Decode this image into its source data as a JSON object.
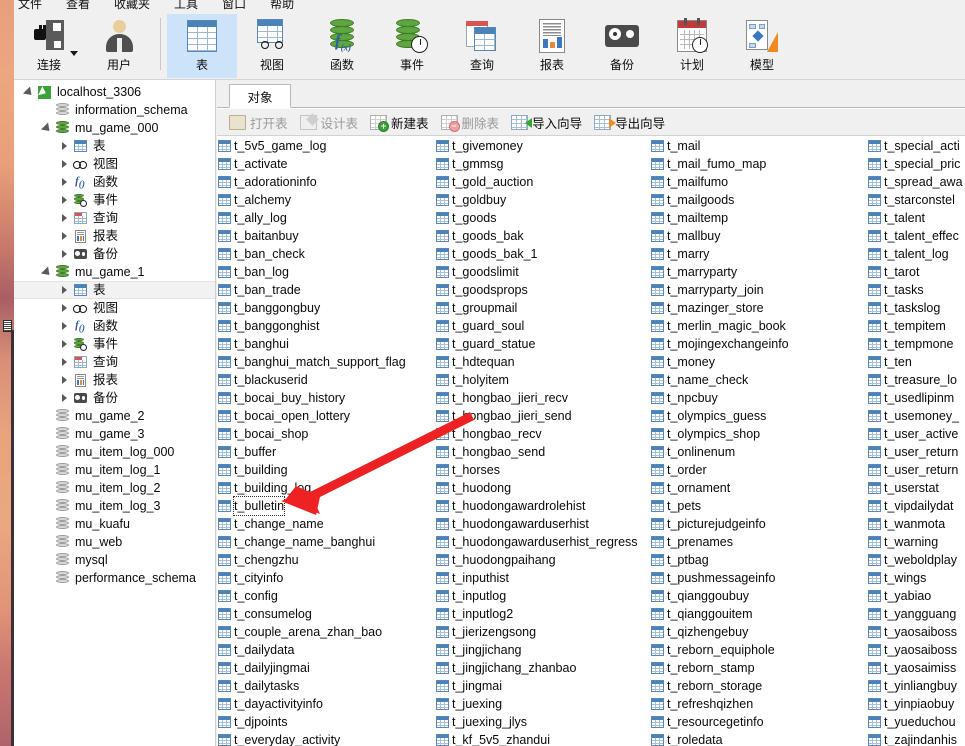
{
  "menu": {
    "items": [
      "文件",
      "查看",
      "收藏夹",
      "工具",
      "窗口",
      "帮助"
    ]
  },
  "toolbar": {
    "buttons": [
      {
        "label": "连接",
        "icon": "connection-icon",
        "active": false,
        "dropdown": true
      },
      {
        "label": "用户",
        "icon": "user-icon",
        "active": false,
        "dropdown": false
      },
      {
        "label": "表",
        "icon": "table-icon",
        "active": true,
        "dropdown": false
      },
      {
        "label": "视图",
        "icon": "view-icon",
        "active": false,
        "dropdown": false
      },
      {
        "label": "函数",
        "icon": "function-icon",
        "active": false,
        "dropdown": false
      },
      {
        "label": "事件",
        "icon": "event-icon",
        "active": false,
        "dropdown": false
      },
      {
        "label": "查询",
        "icon": "query-icon",
        "active": false,
        "dropdown": false
      },
      {
        "label": "报表",
        "icon": "report-icon",
        "active": false,
        "dropdown": false
      },
      {
        "label": "备份",
        "icon": "backup-icon",
        "active": false,
        "dropdown": false
      },
      {
        "label": "计划",
        "icon": "schedule-icon",
        "active": false,
        "dropdown": false
      },
      {
        "label": "模型",
        "icon": "model-icon",
        "active": false,
        "dropdown": false
      }
    ]
  },
  "sidebar": {
    "nodes": [
      {
        "label": "localhost_3306",
        "icon": "host-icon",
        "indent": 0,
        "twisty": "expanded"
      },
      {
        "label": "information_schema",
        "icon": "db-grey-icon",
        "indent": 1,
        "twisty": "none"
      },
      {
        "label": "mu_game_000",
        "icon": "db-green-icon",
        "indent": 1,
        "twisty": "expanded"
      },
      {
        "label": "表",
        "icon": "table-icon",
        "indent": 2,
        "twisty": "collapsed"
      },
      {
        "label": "视图",
        "icon": "view-icon",
        "indent": 2,
        "twisty": "collapsed"
      },
      {
        "label": "函数",
        "icon": "function-icon",
        "indent": 2,
        "twisty": "collapsed"
      },
      {
        "label": "事件",
        "icon": "event-icon",
        "indent": 2,
        "twisty": "collapsed"
      },
      {
        "label": "查询",
        "icon": "query-icon",
        "indent": 2,
        "twisty": "collapsed"
      },
      {
        "label": "报表",
        "icon": "report-icon",
        "indent": 2,
        "twisty": "collapsed"
      },
      {
        "label": "备份",
        "icon": "backup-icon",
        "indent": 2,
        "twisty": "collapsed"
      },
      {
        "label": "mu_game_1",
        "icon": "db-green-icon",
        "indent": 1,
        "twisty": "expanded"
      },
      {
        "label": "表",
        "icon": "table-icon",
        "indent": 2,
        "twisty": "collapsed",
        "selected": true
      },
      {
        "label": "视图",
        "icon": "view-icon",
        "indent": 2,
        "twisty": "collapsed"
      },
      {
        "label": "函数",
        "icon": "function-icon",
        "indent": 2,
        "twisty": "collapsed"
      },
      {
        "label": "事件",
        "icon": "event-icon",
        "indent": 2,
        "twisty": "collapsed"
      },
      {
        "label": "查询",
        "icon": "query-icon",
        "indent": 2,
        "twisty": "collapsed"
      },
      {
        "label": "报表",
        "icon": "report-icon",
        "indent": 2,
        "twisty": "collapsed"
      },
      {
        "label": "备份",
        "icon": "backup-icon",
        "indent": 2,
        "twisty": "collapsed"
      },
      {
        "label": "mu_game_2",
        "icon": "db-grey-icon",
        "indent": 1,
        "twisty": "none"
      },
      {
        "label": "mu_game_3",
        "icon": "db-grey-icon",
        "indent": 1,
        "twisty": "none"
      },
      {
        "label": "mu_item_log_000",
        "icon": "db-grey-icon",
        "indent": 1,
        "twisty": "none"
      },
      {
        "label": "mu_item_log_1",
        "icon": "db-grey-icon",
        "indent": 1,
        "twisty": "none"
      },
      {
        "label": "mu_item_log_2",
        "icon": "db-grey-icon",
        "indent": 1,
        "twisty": "none"
      },
      {
        "label": "mu_item_log_3",
        "icon": "db-grey-icon",
        "indent": 1,
        "twisty": "none"
      },
      {
        "label": "mu_kuafu",
        "icon": "db-grey-icon",
        "indent": 1,
        "twisty": "none"
      },
      {
        "label": "mu_web",
        "icon": "db-grey-icon",
        "indent": 1,
        "twisty": "none"
      },
      {
        "label": "mysql",
        "icon": "db-grey-icon",
        "indent": 1,
        "twisty": "none"
      },
      {
        "label": "performance_schema",
        "icon": "db-grey-icon",
        "indent": 1,
        "twisty": "none"
      }
    ]
  },
  "main": {
    "tab": "对象",
    "actions": [
      {
        "label": "打开表",
        "icon": "open-table-icon",
        "enabled": false
      },
      {
        "label": "设计表",
        "icon": "design-table-icon",
        "enabled": false
      },
      {
        "label": "新建表",
        "icon": "new-table-icon",
        "enabled": true
      },
      {
        "label": "删除表",
        "icon": "delete-table-icon",
        "enabled": false
      },
      {
        "label": "导入向导",
        "icon": "import-wizard-icon",
        "enabled": true
      },
      {
        "label": "导出向导",
        "icon": "export-wizard-icon",
        "enabled": true
      }
    ],
    "focused_table": "t_bulletin",
    "columns": [
      [
        "t_5v5_game_log",
        "t_activate",
        "t_adorationinfo",
        "t_alchemy",
        "t_ally_log",
        "t_baitanbuy",
        "t_ban_check",
        "t_ban_log",
        "t_ban_trade",
        "t_banggongbuy",
        "t_banggonghist",
        "t_banghui",
        "t_banghui_match_support_flag",
        "t_blackuserid",
        "t_bocai_buy_history",
        "t_bocai_open_lottery",
        "t_bocai_shop",
        "t_buffer",
        "t_building",
        "t_building_log",
        "t_bulletin",
        "t_change_name",
        "t_change_name_banghui",
        "t_chengzhu",
        "t_cityinfo",
        "t_config",
        "t_consumelog",
        "t_couple_arena_zhan_bao",
        "t_dailydata",
        "t_dailyjingmai",
        "t_dailytasks",
        "t_dayactivityinfo",
        "t_djpoints",
        "t_everyday_activity"
      ],
      [
        "t_givemoney",
        "t_gmmsg",
        "t_gold_auction",
        "t_goldbuy",
        "t_goods",
        "t_goods_bak",
        "t_goods_bak_1",
        "t_goodslimit",
        "t_goodsprops",
        "t_groupmail",
        "t_guard_soul",
        "t_guard_statue",
        "t_hdtequan",
        "t_holyitem",
        "t_hongbao_jieri_recv",
        "t_hongbao_jieri_send",
        "t_hongbao_recv",
        "t_hongbao_send",
        "t_horses",
        "t_huodong",
        "t_huodongawardrolehist",
        "t_huodongawarduserhist",
        "t_huodongawarduserhist_regress",
        "t_huodongpaihang",
        "t_inputhist",
        "t_inputlog",
        "t_inputlog2",
        "t_jierizengsong",
        "t_jingjichang",
        "t_jingjichang_zhanbao",
        "t_jingmai",
        "t_juexing",
        "t_juexing_jlys",
        "t_kf_5v5_zhandui"
      ],
      [
        "t_mail",
        "t_mail_fumo_map",
        "t_mailfumo",
        "t_mailgoods",
        "t_mailtemp",
        "t_mallbuy",
        "t_marry",
        "t_marryparty",
        "t_marryparty_join",
        "t_mazinger_store",
        "t_merlin_magic_book",
        "t_mojingexchangeinfo",
        "t_money",
        "t_name_check",
        "t_npcbuy",
        "t_olympics_guess",
        "t_olympics_shop",
        "t_onlinenum",
        "t_order",
        "t_ornament",
        "t_pets",
        "t_picturejudgeinfo",
        "t_prenames",
        "t_ptbag",
        "t_pushmessageinfo",
        "t_qianggoubuy",
        "t_qianggouitem",
        "t_qizhengebuy",
        "t_reborn_equiphole",
        "t_reborn_stamp",
        "t_reborn_storage",
        "t_refreshqizhen",
        "t_resourcegetinfo",
        "t_roledata"
      ],
      [
        "t_special_acti",
        "t_special_pric",
        "t_spread_awa",
        "t_starconstel",
        "t_talent",
        "t_talent_effec",
        "t_talent_log",
        "t_tarot",
        "t_tasks",
        "t_taskslog",
        "t_tempitem",
        "t_tempmone",
        "t_ten",
        "t_treasure_lo",
        "t_usedlipinm",
        "t_usemoney_",
        "t_user_active",
        "t_user_return",
        "t_user_return",
        "t_userstat",
        "t_vipdailydat",
        "t_wanmota",
        "t_warning",
        "t_weboldplay",
        "t_wings",
        "t_yabiao",
        "t_yangguang",
        "t_yaosaiboss",
        "t_yaosaiboss",
        "t_yaosaimiss",
        "t_yinliangbuy",
        "t_yinpiaobuy",
        "t_yueduchou",
        "t_zajindanhis"
      ]
    ]
  },
  "annotation": {
    "type": "red-arrow",
    "color": "#ee2222",
    "points_to": "t_bulletin"
  }
}
